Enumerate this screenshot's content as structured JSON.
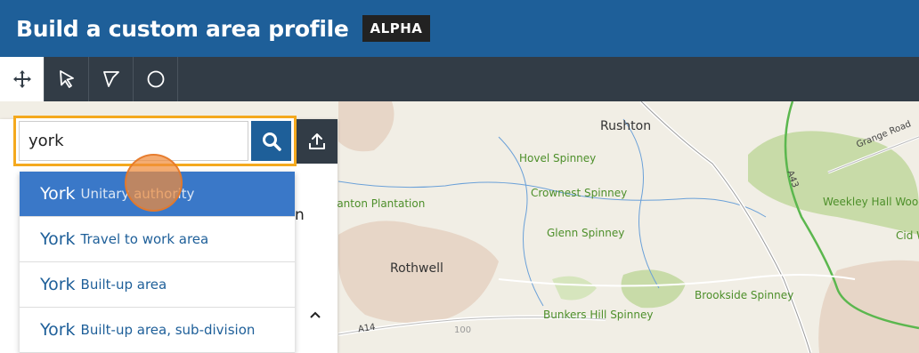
{
  "header": {
    "title": "Build a custom area profile",
    "badge": "ALPHA"
  },
  "toolbar": {
    "tools": [
      {
        "icon": "move-icon",
        "label": "Move"
      },
      {
        "icon": "select-icon",
        "label": "Select"
      },
      {
        "icon": "polygon-icon",
        "label": "Polygon"
      },
      {
        "icon": "circle-icon",
        "label": "Circle"
      }
    ]
  },
  "search": {
    "value": "york",
    "placeholder": ""
  },
  "results": [
    {
      "name": "York",
      "type": "Unitary authority"
    },
    {
      "name": "York",
      "type": "Travel to work area"
    },
    {
      "name": "York",
      "type": "Built-up area"
    },
    {
      "name": "York",
      "type": "Built-up area, sub-division"
    }
  ],
  "panel": {
    "fragment": "n"
  },
  "map": {
    "towns": [
      "Rushton",
      "Rothwell"
    ],
    "woods": [
      "Hovel Spinney",
      "Crownest Spinney",
      "Glenn Spinney",
      "Weekley Hall Wood",
      "Cid W",
      "Brookside Spinney",
      "Bunkers Hill Spinney",
      "Stanton Plantation"
    ],
    "roads": [
      "Grange Road",
      "A43",
      "A14"
    ],
    "spot": "100"
  },
  "colors": {
    "header": "#1e5f99",
    "toolbar": "#323c46",
    "highlight": "#f4a91e",
    "selected": "#3a78c8"
  }
}
